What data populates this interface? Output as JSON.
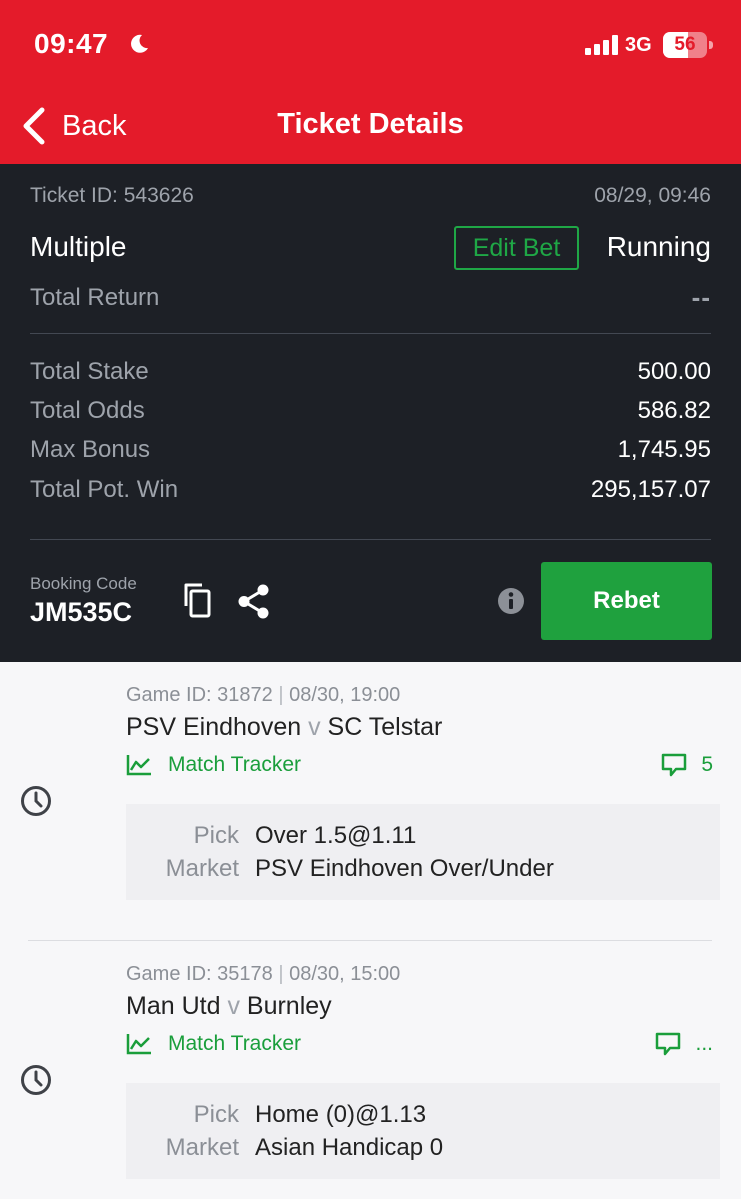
{
  "status_bar": {
    "time": "09:47",
    "network": "3G",
    "battery": "56",
    "battery_level": 0.56
  },
  "nav": {
    "back_label": "Back",
    "title": "Ticket Details"
  },
  "ticket": {
    "id_text": "Ticket ID: 543626",
    "date": "08/29, 09:46",
    "bet_type": "Multiple",
    "edit_label": "Edit Bet",
    "status": "Running",
    "total_return_label": "Total Return",
    "total_return_value": "--",
    "rows": [
      {
        "label": "Total Stake",
        "value": "500.00"
      },
      {
        "label": "Total Odds",
        "value": "586.82"
      },
      {
        "label": "Max Bonus",
        "value": "1,745.95"
      },
      {
        "label": "Total Pot. Win",
        "value": "295,157.07"
      }
    ],
    "booking_label": "Booking Code",
    "booking_code": "JM535C",
    "rebet_label": "Rebet"
  },
  "selections": [
    {
      "game_id": "Game ID: 31872",
      "datetime": "08/30, 19:00",
      "home": "PSV Eindhoven",
      "vs": "v",
      "away": "SC Telstar",
      "tracker_label": "Match Tracker",
      "comment_count": "5",
      "pick_label": "Pick",
      "pick": "Over 1.5@1.11",
      "market_label": "Market",
      "market": "PSV Eindhoven Over/Under"
    },
    {
      "game_id": "Game ID: 35178",
      "datetime": "08/30, 15:00",
      "home": "Man Utd",
      "vs": "v",
      "away": "Burnley",
      "tracker_label": "Match Tracker",
      "comment_count": "...",
      "pick_label": "Pick",
      "pick": "Home (0)@1.13",
      "market_label": "Market",
      "market": "Asian Handicap 0"
    }
  ],
  "colors": {
    "brand_red": "#e41b2a",
    "dark_bg": "#1d2026",
    "green": "#1fa13e"
  },
  "icons": [
    "moon-icon",
    "signal-icon",
    "battery-icon",
    "back-chevron-icon",
    "copy-icon",
    "share-icon",
    "info-icon",
    "chart-icon",
    "comment-icon",
    "clock-icon"
  ]
}
